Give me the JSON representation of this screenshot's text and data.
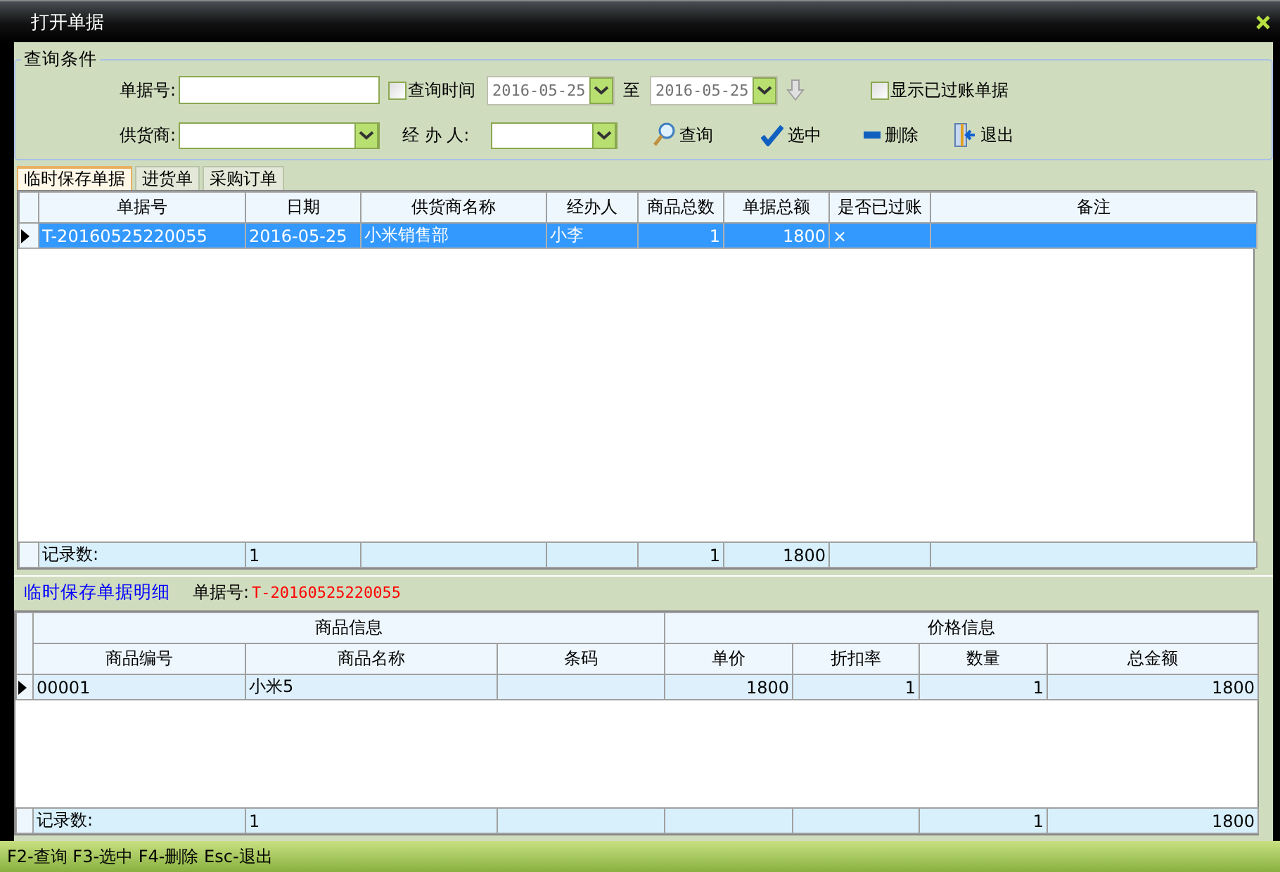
{
  "window": {
    "title": "打开单据"
  },
  "query": {
    "legend": "查询条件",
    "bill_no": {
      "label": "单据号:"
    },
    "date_filter": {
      "label": "查询时间",
      "checked": false,
      "from": "2016-05-25",
      "to_label": "至",
      "to": "2016-05-25",
      "disabled": true
    },
    "show_posted": {
      "label": "显示已过账单据",
      "checked": false
    },
    "supplier": {
      "label": "供货商:"
    },
    "handler": {
      "label": "经 办 人:"
    },
    "actions": [
      {
        "kind": "search",
        "label": "查询"
      },
      {
        "kind": "select",
        "label": "选中"
      },
      {
        "kind": "delete",
        "label": "删除"
      },
      {
        "kind": "exit",
        "label": "退出"
      }
    ]
  },
  "tabs": [
    {
      "label": "临时保存单据",
      "selected": true
    },
    {
      "label": "进货单",
      "selected": false
    },
    {
      "label": "采购订单",
      "selected": false
    }
  ],
  "grid": {
    "rows": [
      {
        "selected": true,
        "current": true
      }
    ],
    "columns": [
      {
        "label": "单据号",
        "kind": "text",
        "cells": [
          "T-20160525220055"
        ],
        "footer": "记录数:"
      },
      {
        "label": "日期",
        "kind": "text",
        "cells": [
          "2016-05-25"
        ],
        "footer": "1"
      },
      {
        "label": "供货商名称",
        "kind": "text",
        "cells": [
          "小米销售部"
        ]
      },
      {
        "label": "经办人",
        "kind": "text",
        "cells": [
          "小李"
        ]
      },
      {
        "label": "商品总数",
        "kind": "number",
        "cells": [
          "1"
        ],
        "footer": "1"
      },
      {
        "label": "单据总额",
        "kind": "number",
        "cells": [
          "1800"
        ],
        "footer": "1800"
      },
      {
        "label": "是否已过账",
        "kind": "text",
        "cells": [
          "×"
        ]
      },
      {
        "label": "备注",
        "kind": "text"
      }
    ]
  },
  "detail": {
    "title": "临时保存单据明细",
    "bill_label": "单据号:",
    "bill_no": "T-20160525220055",
    "rows": [
      {
        "selected": false,
        "current": true
      }
    ],
    "groups": [
      {
        "label": "商品信息",
        "columns": [
          {
            "label": "商品编号",
            "kind": "text",
            "cells": [
              "00001"
            ],
            "footer": "记录数:"
          },
          {
            "label": "商品名称",
            "kind": "text",
            "cells": [
              "小米5"
            ],
            "footer": "1"
          },
          {
            "label": "条码",
            "kind": "text"
          }
        ]
      },
      {
        "label": "价格信息",
        "columns": [
          {
            "label": "单价",
            "kind": "number",
            "cells": [
              "1800"
            ]
          },
          {
            "label": "折扣率",
            "kind": "number",
            "cells": [
              "1"
            ]
          },
          {
            "label": "数量",
            "kind": "number",
            "cells": [
              "1"
            ],
            "footer": "1"
          },
          {
            "label": "总金额",
            "kind": "number",
            "cells": [
              "1800"
            ],
            "footer": "1800"
          }
        ]
      }
    ]
  },
  "status_bar": "F2-查询 F3-选中 F4-删除 Esc-退出"
}
